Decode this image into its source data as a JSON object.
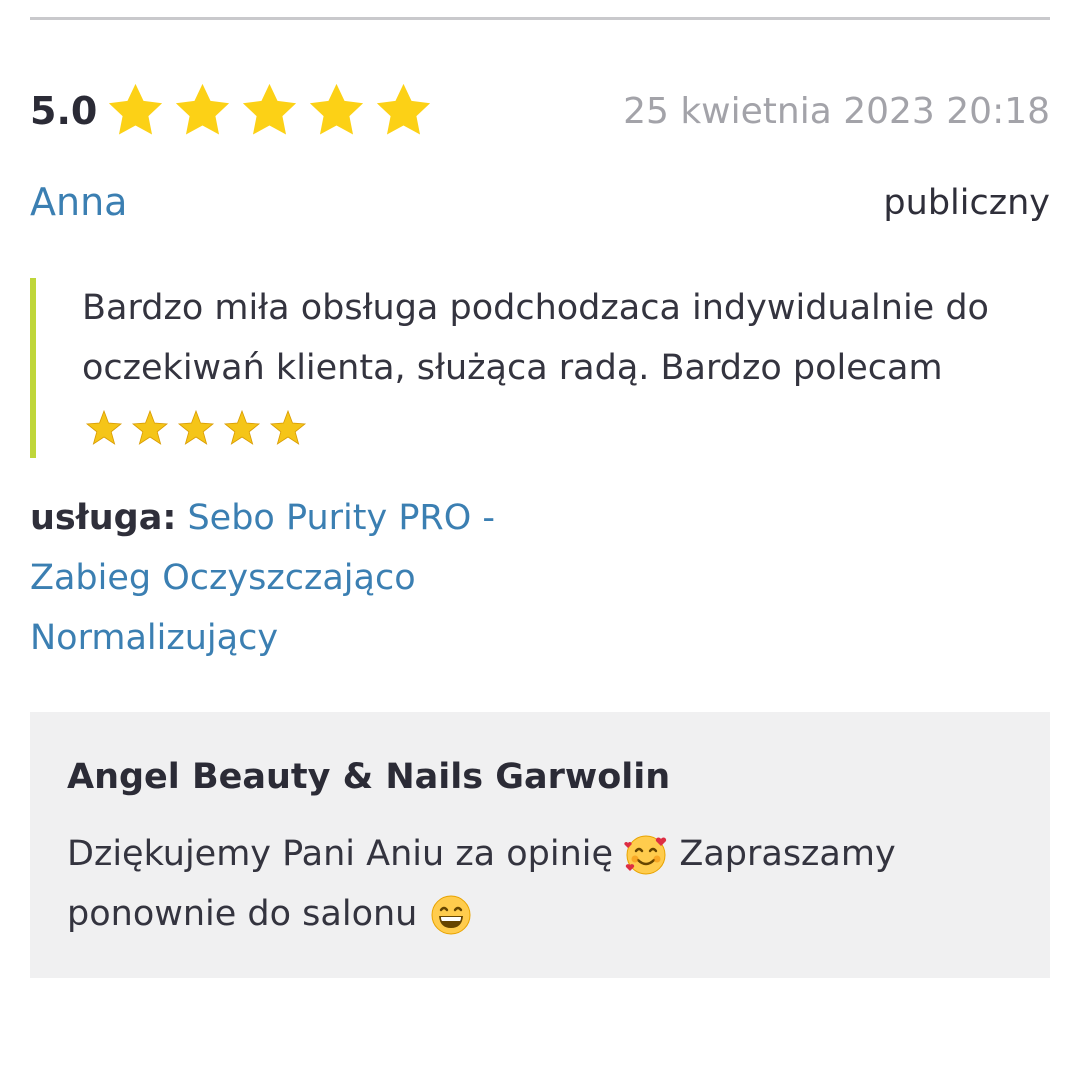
{
  "review": {
    "rating_value": "5.0",
    "rating_stars": 5,
    "date": "25 kwietnia 2023 20:18",
    "author": "Anna",
    "visibility": "publiczny",
    "text": "Bardzo miła obsługa podchodzaca indywidualnie do oczekiwań klienta, służąca radą. Bardzo polecam",
    "text_emoji": "star-sparkle-icon x5",
    "service_label": "usługa:",
    "service_name": "Sebo Purity PRO - Zabieg Oczyszczająco Normalizujący"
  },
  "reply": {
    "business_name": "Angel Beauty & Nails Garwolin",
    "text_part1": "Dziękujemy Pani Aniu za opinię",
    "text_part2": "Zapraszamy ponownie do salonu",
    "emoji1": "smiling-face-with-hearts-icon",
    "emoji2": "grinning-face-icon"
  },
  "colors": {
    "star": "#FCD116",
    "link": "#3b7fb2",
    "accent_bar": "#bfd63a",
    "date": "#a3a3a9",
    "reply_bg": "#f0f0f1"
  }
}
